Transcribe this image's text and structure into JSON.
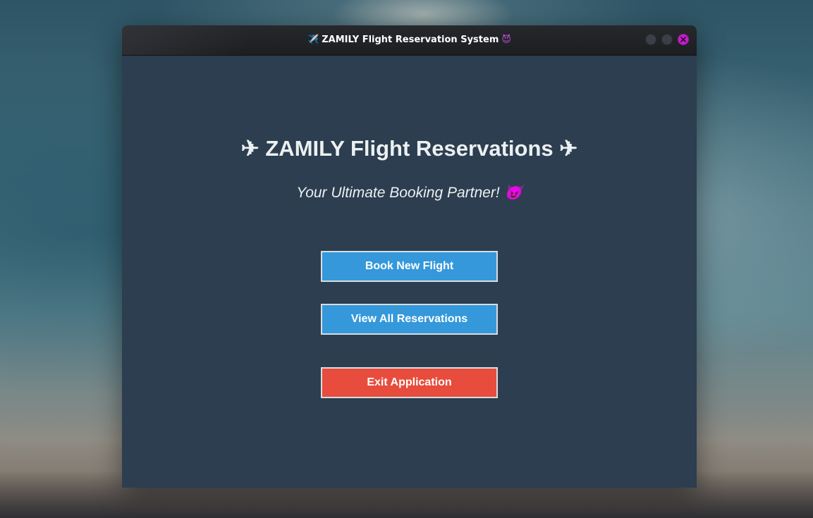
{
  "window": {
    "title": "ZAMILY Flight Reservation System",
    "title_prefix_icon": "airplane-icon",
    "title_suffix_icon": "devil-emoji-icon",
    "title_prefix_glyph": "✈️",
    "title_suffix_glyph": "😈",
    "controls": [
      "minimize-button",
      "maximize-button",
      "close-button"
    ]
  },
  "main": {
    "heading": "✈ ZAMILY Flight Reservations ✈",
    "subheading": "Your Ultimate Booking Partner! 😈",
    "buttons": {
      "book": "Book New Flight",
      "view": "View All Reservations",
      "exit": "Exit Application"
    }
  },
  "colors": {
    "window_bg": "#2c3e50",
    "primary_button": "#3498db",
    "danger_button": "#e74c3c",
    "close_button": "#c21fc7",
    "text": "#ecf0f1"
  }
}
